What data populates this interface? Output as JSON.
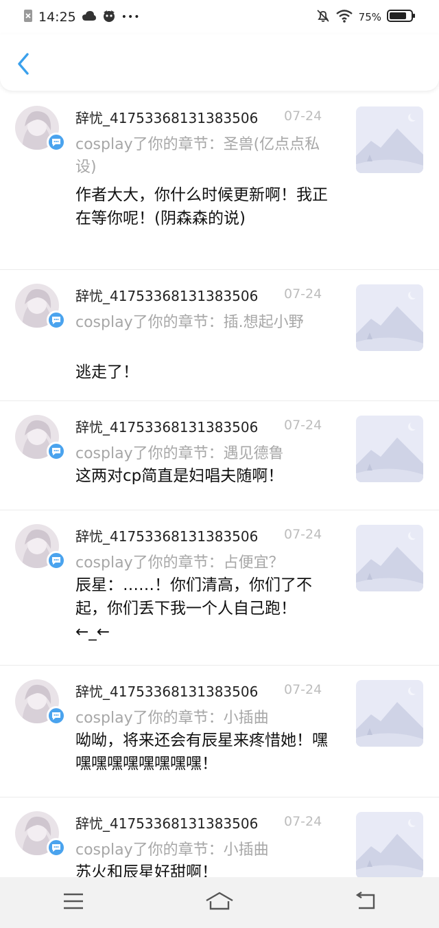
{
  "status_bar": {
    "time": "14:25",
    "more": "•••",
    "battery": "75%"
  },
  "header": {
    "back_icon": "chevron-left-icon",
    "accent": "#3aa0ec"
  },
  "notifications": [
    {
      "name": "辞忧_41753368131383506",
      "date": "07-24",
      "chapter": "cosplay了你的章节：圣兽(亿点点私设)",
      "content": "作者大大，你什么时候更新啊！我正在等你呢！(阴森森的说)"
    },
    {
      "name": "辞忧_41753368131383506",
      "date": "07-24",
      "chapter": "cosplay了你的章节：插.想起小野",
      "content": "逃走了！"
    },
    {
      "name": "辞忧_41753368131383506",
      "date": "07-24",
      "chapter": "cosplay了你的章节：遇见德鲁",
      "content": "这两对cp简直是妇唱夫随啊！"
    },
    {
      "name": "辞忧_41753368131383506",
      "date": "07-24",
      "chapter": "cosplay了你的章节：占便宜？",
      "content": "辰星：……！你们清高，你们了不起，你们丢下我一个人自己跑！←_←"
    },
    {
      "name": "辞忧_41753368131383506",
      "date": "07-24",
      "chapter": "cosplay了你的章节：小插曲",
      "content": "呦呦，将来还会有辰星来疼惜她！嘿嘿嘿嘿嘿嘿嘿嘿嘿！"
    },
    {
      "name": "辞忧_41753368131383506",
      "date": "07-24",
      "chapter": "cosplay了你的章节：小插曲",
      "content": "苏火和辰星好甜啊！"
    }
  ],
  "nav": {
    "menu_icon": "menu-icon",
    "home_icon": "home-icon",
    "back_icon": "back-icon"
  }
}
